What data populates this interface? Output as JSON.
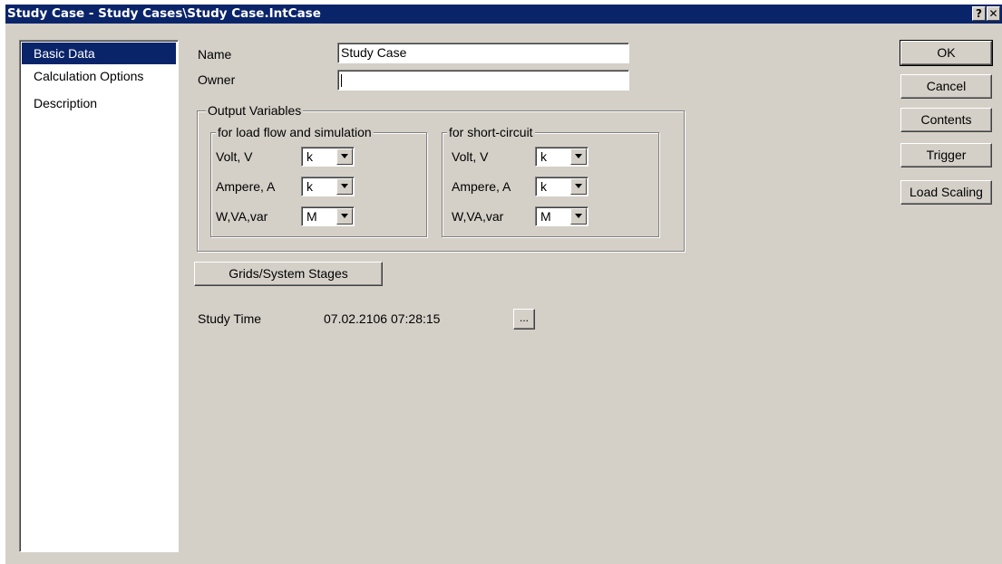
{
  "window": {
    "title": "Study Case - Study Cases\\Study Case.IntCase",
    "help_label": "?",
    "close_label": "✕"
  },
  "sidebar": {
    "items": [
      {
        "label": "Basic Data",
        "active": true
      },
      {
        "label": "Calculation Options",
        "active": false
      },
      {
        "label": "Description",
        "active": false
      }
    ]
  },
  "form": {
    "name_label": "Name",
    "name_value": "Study Case",
    "owner_label": "Owner",
    "owner_value": "",
    "output_variables": {
      "title": "Output Variables",
      "load_flow": {
        "title": "for load flow and simulation",
        "rows": [
          {
            "label": "Volt, V",
            "value": "k"
          },
          {
            "label": "Ampere, A",
            "value": "k"
          },
          {
            "label": "W,VA,var",
            "value": "M"
          }
        ]
      },
      "short_circuit": {
        "title": "for short-circuit",
        "rows": [
          {
            "label": "Volt, V",
            "value": "k"
          },
          {
            "label": "Ampere, A",
            "value": "k"
          },
          {
            "label": "W,VA,var",
            "value": "M"
          }
        ]
      }
    },
    "grids_button": "Grids/System Stages",
    "study_time_label": "Study Time",
    "study_time_value": "07.02.2106 07:28:15",
    "study_time_button": "..."
  },
  "buttons": {
    "ok": "OK",
    "cancel": "Cancel",
    "contents": "Contents",
    "trigger": "Trigger",
    "load_scaling": "Load Scaling"
  },
  "colors": {
    "titlebar": "#0a246a",
    "dialog_bg": "#d4d0c8",
    "selection": "#0a246a"
  }
}
